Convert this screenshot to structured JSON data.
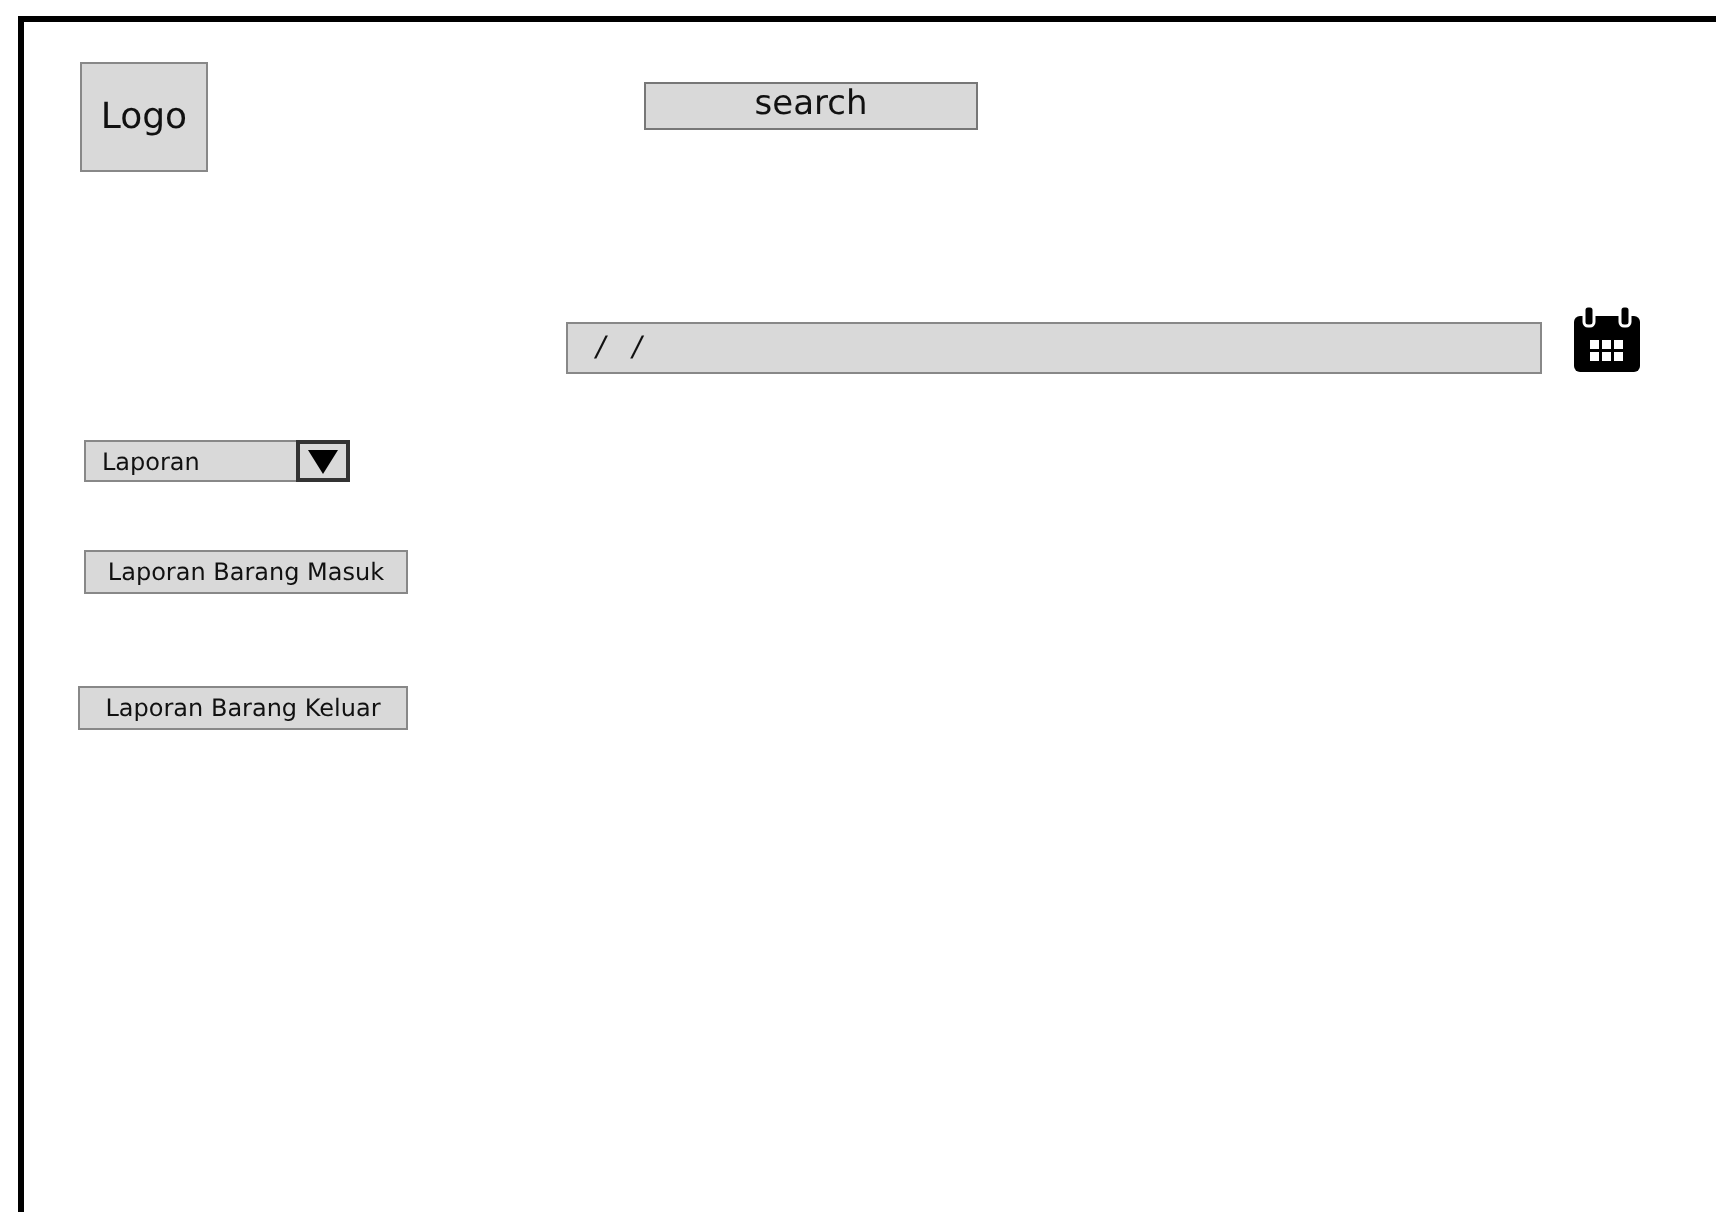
{
  "logo": "Logo",
  "search": {
    "label": "search"
  },
  "date_field": {
    "value": "/   /"
  },
  "dropdown": {
    "value": "Laporan",
    "expanded": false
  },
  "buttons": [
    "Laporan Barang Masuk",
    "Laporan Barang Keluar"
  ]
}
